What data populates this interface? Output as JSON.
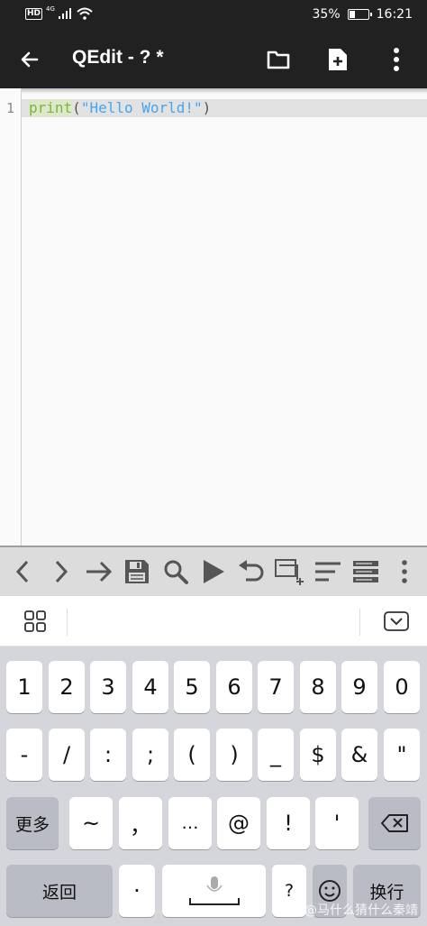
{
  "status_bar": {
    "hd": "HD",
    "network": "4G",
    "battery_percent_text": "35%",
    "battery_level": 0.35,
    "time": "16:21"
  },
  "app_bar": {
    "title": "QEdit - ? *",
    "icons": [
      "back-arrow-icon",
      "folder-icon",
      "new-file-icon",
      "more-vert-icon"
    ]
  },
  "editor": {
    "lines": [
      {
        "number": "1",
        "fn": "print",
        "open": "(",
        "string": "\"Hello World!\"",
        "close": ")"
      }
    ]
  },
  "toolbar": {
    "icons": [
      "chevron-left-icon",
      "chevron-right-icon",
      "arrow-right-icon",
      "save-icon",
      "search-icon",
      "play-icon",
      "undo-icon",
      "add-tab-icon",
      "format-lines-icon",
      "list-icon",
      "more-vert-icon"
    ]
  },
  "keyboard": {
    "row1": [
      "1",
      "2",
      "3",
      "4",
      "5",
      "6",
      "7",
      "8",
      "9",
      "0"
    ],
    "row2": [
      "-",
      "/",
      ":",
      ";",
      "(",
      ")",
      "_",
      "$",
      "&",
      "\""
    ],
    "row3": {
      "more": "更多",
      "keys": [
        "~",
        "，",
        "…",
        "@",
        "!",
        "'"
      ]
    },
    "row4": {
      "back": "返回",
      "dot": "·",
      "question": "?",
      "enter": "换行"
    }
  },
  "watermark": "知乎 @马什么猜什么秦靖"
}
